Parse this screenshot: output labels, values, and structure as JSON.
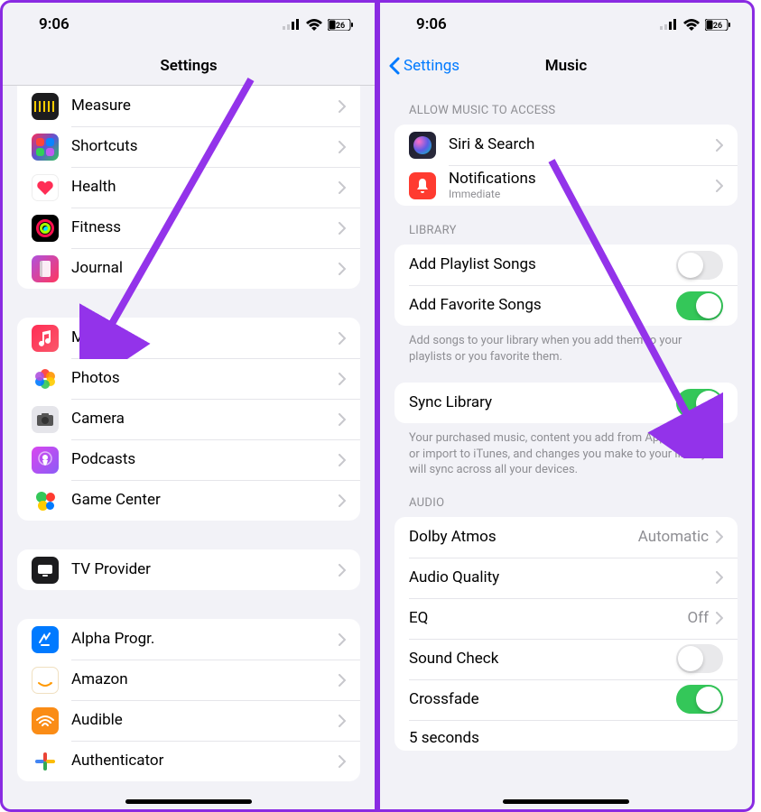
{
  "status": {
    "time": "9:06",
    "battery": "26"
  },
  "left": {
    "title": "Settings",
    "group1": [
      {
        "label": "Measure"
      },
      {
        "label": "Shortcuts"
      },
      {
        "label": "Health"
      },
      {
        "label": "Fitness"
      },
      {
        "label": "Journal"
      }
    ],
    "group2": [
      {
        "label": "Music"
      },
      {
        "label": "Photos"
      },
      {
        "label": "Camera"
      },
      {
        "label": "Podcasts"
      },
      {
        "label": "Game Center"
      }
    ],
    "group3": [
      {
        "label": "TV Provider"
      }
    ],
    "group4": [
      {
        "label": "Alpha Progr."
      },
      {
        "label": "Amazon"
      },
      {
        "label": "Audible"
      },
      {
        "label": "Authenticator"
      }
    ]
  },
  "right": {
    "back": "Settings",
    "title": "Music",
    "sections": {
      "access": {
        "header": "ALLOW MUSIC TO ACCESS",
        "siri": "Siri & Search",
        "notif": "Notifications",
        "notif_sub": "Immediate"
      },
      "library": {
        "header": "LIBRARY",
        "add_playlist": "Add Playlist Songs",
        "add_favorite": "Add Favorite Songs",
        "footer1": "Add songs to your library when you add them to your playlists or you favorite them.",
        "sync": "Sync Library",
        "footer2": "Your purchased music, content you add from Apple Music or import to iTunes, and changes you make to your library will sync across all your devices."
      },
      "audio": {
        "header": "AUDIO",
        "dolby": "Dolby Atmos",
        "dolby_val": "Automatic",
        "quality": "Audio Quality",
        "eq": "EQ",
        "eq_val": "Off",
        "sound_check": "Sound Check",
        "crossfade": "Crossfade",
        "crossfade_val": "5 seconds"
      }
    }
  }
}
